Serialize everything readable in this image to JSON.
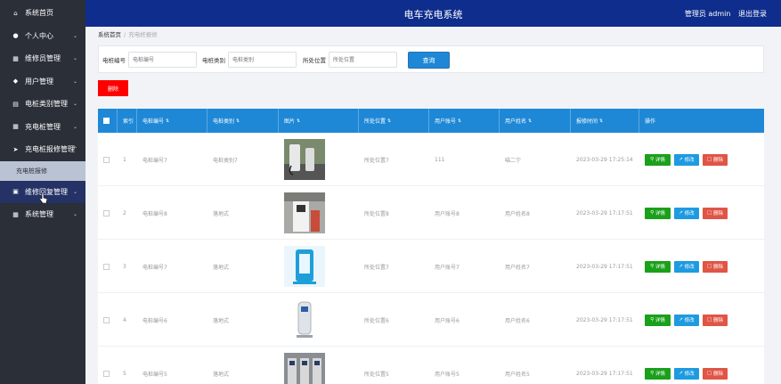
{
  "app_title": "电车充电系统",
  "header": {
    "user_label": "管理员 admin",
    "logout": "退出登录"
  },
  "sidebar": {
    "items": [
      {
        "label": "系统首页",
        "icon": "home-icon"
      },
      {
        "label": "个人中心",
        "icon": "user-icon"
      },
      {
        "label": "维修员管理",
        "icon": "grid-icon"
      },
      {
        "label": "用户管理",
        "icon": "shield-icon"
      },
      {
        "label": "电桩类别管理",
        "icon": "book-icon"
      },
      {
        "label": "充电桩管理",
        "icon": "grid-icon"
      },
      {
        "label": "充电桩报修管理",
        "icon": "send-icon"
      },
      {
        "label": "维修回复管理",
        "icon": "list-icon"
      },
      {
        "label": "系统管理",
        "icon": "grid-icon"
      }
    ],
    "sub_item": "充电桩报修",
    "active_color": "#243266"
  },
  "breadcrumb": {
    "home": "系统首页",
    "sep": "/",
    "current": "充电桩报修"
  },
  "search": {
    "fields": [
      {
        "label": "电桩编号",
        "placeholder": "电桩编号"
      },
      {
        "label": "电桩类别",
        "placeholder": "电桩类别"
      },
      {
        "label": "所处位置",
        "placeholder": "所处位置"
      }
    ],
    "query_button": "查询"
  },
  "delete_button": "删除",
  "table": {
    "headers": [
      "",
      "索引",
      "电桩编号",
      "电桩类别",
      "图片",
      "所处位置",
      "用户账号",
      "用户姓名",
      "报修时间",
      "操作"
    ],
    "rows": [
      {
        "index": "1",
        "code": "电桩编号7",
        "category": "电桩类别7",
        "location": "所处位置7",
        "account": "111",
        "name": "喵二宁",
        "time": "2023-03-29 17:25:14",
        "img": "charger-photo-1"
      },
      {
        "index": "2",
        "code": "电桩编号8",
        "category": "落地式",
        "location": "所处位置8",
        "account": "用户账号8",
        "name": "用户姓名8",
        "time": "2023-03-29 17:17:51",
        "img": "charger-photo-2"
      },
      {
        "index": "3",
        "code": "电桩编号7",
        "category": "落地式",
        "location": "所处位置7",
        "account": "用户账号7",
        "name": "用户姓名7",
        "time": "2023-03-29 17:17:51",
        "img": "charger-photo-3"
      },
      {
        "index": "4",
        "code": "电桩编号6",
        "category": "落地式",
        "location": "所处位置6",
        "account": "用户账号6",
        "name": "用户姓名6",
        "time": "2023-03-29 17:17:51",
        "img": "charger-photo-4"
      },
      {
        "index": "5",
        "code": "电桩编号5",
        "category": "落地式",
        "location": "所处位置5",
        "account": "用户账号5",
        "name": "用户姓名5",
        "time": "2023-03-29 17:17:51",
        "img": "charger-photo-5"
      }
    ],
    "actions": {
      "detail": "详情",
      "edit": "修改",
      "delete": "删除"
    }
  },
  "colors": {
    "header": "#0e2d8c",
    "sidebar": "#2b2f38",
    "table_head": "#1e88d6",
    "detail": "#1aa01a",
    "edit": "#1e9be0",
    "delete": "#e05545",
    "danger": "#ff0000"
  }
}
